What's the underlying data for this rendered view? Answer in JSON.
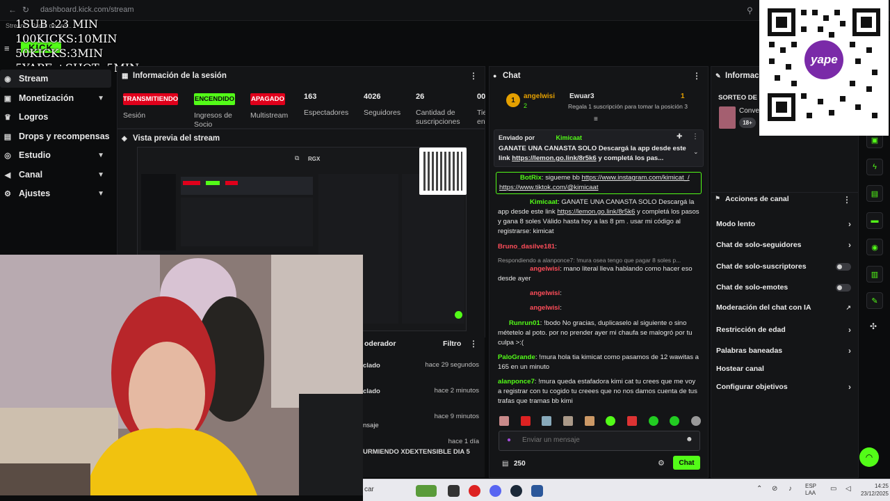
{
  "browser": {
    "url": "dashboard.kick.com/stream",
    "tab_title": "Stream · Panel de cre..."
  },
  "overlay_goals": [
    "1SUB :23 MIN",
    "100KICKS:10MIN",
    "50KICKS:3MIN",
    "5YAPE +SHOT :5MIN"
  ],
  "sidebar": {
    "items": [
      {
        "label": "Stream",
        "icon": "broadcast-icon",
        "active": true
      },
      {
        "label": "Monetización",
        "icon": "wallet-icon",
        "chevron": true
      },
      {
        "label": "Logros",
        "icon": "trophy-icon"
      },
      {
        "label": "Drops y recompensas",
        "icon": "gift-icon"
      },
      {
        "label": "Estudio",
        "icon": "camera-icon",
        "chevron": true
      },
      {
        "label": "Canal",
        "icon": "megaphone-icon",
        "chevron": true
      },
      {
        "label": "Ajustes",
        "icon": "gear-icon",
        "chevron": true
      }
    ]
  },
  "session": {
    "title": "Información de la sesión",
    "badges": [
      {
        "label": "TRANSMITIENDO",
        "color": "#e0001b",
        "caption": "Sesión"
      },
      {
        "label": "ENCENDIDO",
        "color": "#53fc18",
        "caption": "Ingresos de Socio"
      },
      {
        "label": "APAGADO",
        "color": "#e0001b",
        "caption": "Multistream"
      }
    ],
    "stats": [
      {
        "value": "163",
        "label": "Espectadores"
      },
      {
        "value": "4026",
        "label": "Seguidores"
      },
      {
        "value": "26",
        "label": "Cantidad de suscripciones"
      },
      {
        "value": "00:",
        "label": "Tie en"
      }
    ]
  },
  "preview": {
    "title": "Vista previa del stream",
    "badge": "RGX"
  },
  "moderator": {
    "title": "oderador",
    "filter_label": "Filtro",
    "rows": [
      {
        "text": "clado",
        "time": "hace 29 segundos"
      },
      {
        "text": "clado",
        "time": "hace 2 minutos"
      },
      {
        "text": "nsaje",
        "time": "hace 9 minutos"
      },
      {
        "text": "URMIENDO XDEXTENSIBLE DIA 5",
        "time": "hace 1 día"
      }
    ]
  },
  "chat": {
    "title": "Chat",
    "top_gifter": {
      "name": "angelwisi",
      "rank": "1",
      "count": "2"
    },
    "second": {
      "name": "Ewuar3",
      "rank": "1",
      "note": "Regala 1 suscripción para tomar la posición 3"
    },
    "pinned": {
      "by_label": "Enviado por",
      "by_user": "Kimicaat",
      "text": "GANATE UNA CANASTA SOLO Descargá la app desde este link ",
      "link": "https://lemon.go.link/8r5k6",
      "tail": " y completá los pas..."
    },
    "messages": [
      {
        "user": "BotRix",
        "color": "#53fc18",
        "text": ": sigueme bb ",
        "link": "https://www.instagram.com/kimicat_/ https://www.tiktok.com/@kimicaat",
        "tail": ""
      },
      {
        "user": "Kimicaat",
        "color": "#53fc18",
        "text": ": GANATE UNA CANASTA SOLO Descargá la app desde este link ",
        "link": "https://lemon.go.link/8r5k6",
        "tail": " y completá los pasos y gana 8 soles Válido hasta hoy a las 8 pm . usar mi código al registrarse: kimicat"
      },
      {
        "user": "Bruno_dasilve181",
        "color": "#ff4d5a",
        "text": ":",
        "link": "",
        "tail": ""
      },
      {
        "user": "angelwisi",
        "color": "#ff4d5a",
        "reply": "Respondiendo a alanponce7: !mura osea tengo que pagar 8 soles p...",
        "text": ": mano literal lleva hablando como hacer eso desde ayer",
        "link": "",
        "tail": ""
      },
      {
        "user": "angelwisi",
        "color": "#ff4d5a",
        "text": ":",
        "link": "",
        "tail": ""
      },
      {
        "user": "angelwisi",
        "color": "#ff4d5a",
        "text": ":",
        "link": "",
        "tail": ""
      },
      {
        "user": "Runrun01",
        "color": "#53fc18",
        "text": ": !bodo No gracias, duplicaselo al siguiente o sino métetelo al poto. por no prender ayer mi chaufa se malogró por tu culpa >:(",
        "link": "",
        "tail": ""
      },
      {
        "user": "PaloGrande",
        "color": "#53fc18",
        "text": ": !mura hola tia kimicat como pasamos de 12 wawitas a 165 en un minuto",
        "link": "",
        "tail": ""
      },
      {
        "user": "alanponce7",
        "color": "#53fc18",
        "text": ": !mura queda estafadora kimi cat tu crees que me voy a registrar con tu cogido tu creees que no nos damos cuenta de tus trafas que tramas bb kimi",
        "link": "",
        "tail": ""
      }
    ],
    "input_placeholder": "Enviar un mensaje",
    "points": "250",
    "send_label": "Chat"
  },
  "actions": {
    "info_title": "Informació",
    "giveaway": "SORTEO DE C",
    "giveaway_sub": "Conve",
    "age_badge": "18+",
    "title": "Acciones de canal",
    "items": [
      {
        "label": "Modo lento",
        "control": "chevron"
      },
      {
        "label": "Chat de solo-seguidores",
        "control": "chevron"
      },
      {
        "label": "Chat de solo-suscriptores",
        "control": "toggle"
      },
      {
        "label": "Chat de solo-emotes",
        "control": "toggle"
      },
      {
        "label": "Moderación del chat con IA",
        "control": "external"
      },
      {
        "label": "Restricción de edad",
        "control": "chevron"
      },
      {
        "label": "Palabras baneadas",
        "control": "chevron"
      },
      {
        "label": "Hostear canal",
        "control": "none"
      },
      {
        "label": "Configurar objetivos",
        "control": "chevron"
      }
    ]
  },
  "qr": {
    "brand": "yape"
  },
  "taskbar": {
    "search": "car",
    "lang": "ESP",
    "lang2": "LAA",
    "time": "14:25",
    "date": "23/12/2025"
  },
  "colors": {
    "kick_green": "#53fc18",
    "live_red": "#e0001b",
    "panel": "#141517"
  }
}
